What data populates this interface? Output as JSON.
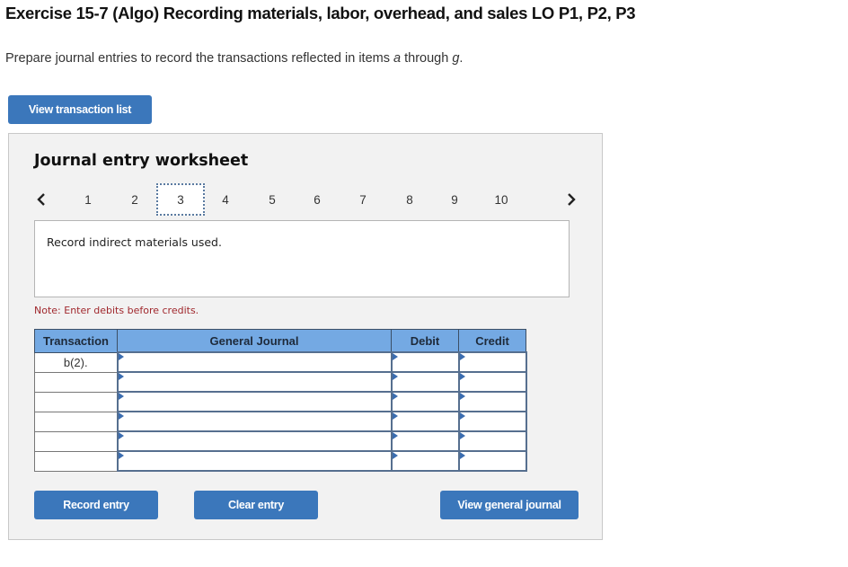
{
  "header": {
    "title": "Exercise 15-7 (Algo) Recording materials, labor, overhead, and sales LO P1, P2, P3",
    "instruction_prefix": "Prepare journal entries to record the transactions reflected in items ",
    "instruction_item_start": "a",
    "instruction_middle": " through ",
    "instruction_item_end": "g",
    "instruction_suffix": "."
  },
  "buttons": {
    "view_transaction_list": "View transaction list",
    "record_entry": "Record entry",
    "clear_entry": "Clear entry",
    "view_general_journal": "View general journal"
  },
  "worksheet": {
    "title": "Journal entry worksheet",
    "pager": {
      "prev_icon": "chevron-left-icon",
      "next_icon": "chevron-right-icon",
      "pages": [
        "1",
        "2",
        "3",
        "4",
        "5",
        "6",
        "7",
        "8",
        "9",
        "10"
      ],
      "active_page": "3"
    },
    "description": "Record indirect materials used.",
    "note": "Note: Enter debits before credits."
  },
  "journal_table": {
    "columns": [
      "Transaction",
      "General Journal",
      "Debit",
      "Credit"
    ],
    "rows": [
      {
        "transaction": "b(2).",
        "account": "",
        "debit": "",
        "credit": ""
      },
      {
        "transaction": "",
        "account": "",
        "debit": "",
        "credit": ""
      },
      {
        "transaction": "",
        "account": "",
        "debit": "",
        "credit": ""
      },
      {
        "transaction": "",
        "account": "",
        "debit": "",
        "credit": ""
      },
      {
        "transaction": "",
        "account": "",
        "debit": "",
        "credit": ""
      },
      {
        "transaction": "",
        "account": "",
        "debit": "",
        "credit": ""
      }
    ]
  },
  "colors": {
    "button_blue": "#3b77bb",
    "table_header_blue": "#74a9e3",
    "note_red": "#a0282d",
    "panel_bg": "#f2f2f2"
  }
}
